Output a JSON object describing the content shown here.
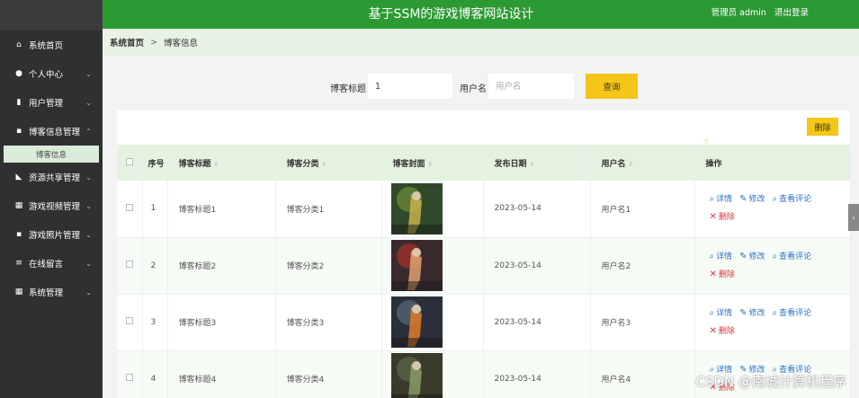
{
  "header": {
    "title": "基于SSM的游戏博客网站设计",
    "user": "管理员 admin",
    "logout": "退出登录"
  },
  "sidebar": {
    "items": [
      {
        "label": "系统首页",
        "icon": "home-icon",
        "glyph": "⌂",
        "chev": ""
      },
      {
        "label": "个人中心",
        "icon": "person-icon",
        "glyph": "●",
        "chev": "⌄"
      },
      {
        "label": "用户管理",
        "icon": "bar-chart-icon",
        "glyph": "▮",
        "chev": "⌄"
      },
      {
        "label": "博客信息管理",
        "icon": "file-icon",
        "glyph": "▪",
        "chev": "⌃"
      },
      {
        "label": "资源共享管理",
        "icon": "thumb-icon",
        "glyph": "◣",
        "chev": "⌄"
      },
      {
        "label": "游戏视频管理",
        "icon": "grid-icon",
        "glyph": "▦",
        "chev": "⌄"
      },
      {
        "label": "游戏照片管理",
        "icon": "file-icon",
        "glyph": "▪",
        "chev": "⌄"
      },
      {
        "label": "在线留言",
        "icon": "list-icon",
        "glyph": "≡",
        "chev": "⌄"
      },
      {
        "label": "系统管理",
        "icon": "grid-icon",
        "glyph": "▦",
        "chev": "⌄"
      }
    ],
    "sub_item": "博客信息"
  },
  "breadcrumb": {
    "home": "系统首页",
    "sep": ">",
    "current": "博客信息"
  },
  "search": {
    "title_label": "博客标题",
    "title_value": "1",
    "user_label": "用户名",
    "user_placeholder": "用户名",
    "query_button": "查询"
  },
  "toolbar": {
    "delete_button": "删除"
  },
  "table": {
    "headers": {
      "index": "序号",
      "title": "博客标题",
      "category": "博客分类",
      "cover": "博客封面",
      "date": "发布日期",
      "user": "用户名",
      "ops": "操作"
    },
    "sort_glyph": "⇕",
    "ops": {
      "detail": "详情",
      "edit": "修改",
      "comments": "查看评论",
      "delete": "删除"
    },
    "rows": [
      {
        "index": "1",
        "title": "博客标题1",
        "category": "博客分类1",
        "date": "2023-05-14",
        "user": "用户名1"
      },
      {
        "index": "2",
        "title": "博客标题2",
        "category": "博客分类2",
        "date": "2023-05-14",
        "user": "用户名2"
      },
      {
        "index": "3",
        "title": "博客标题3",
        "category": "博客分类3",
        "date": "2023-05-14",
        "user": "用户名3"
      },
      {
        "index": "4",
        "title": "博客标题4",
        "category": "博客分类4",
        "date": "2023-05-14",
        "user": "用户名4"
      }
    ]
  },
  "watermark": "CSDN @南城计算机程序",
  "colors": {
    "header": "#2c9a33",
    "sidebar": "#2f3032",
    "accent_button": "#f5c518",
    "link": "#2b72c8",
    "danger": "#d9363e"
  }
}
